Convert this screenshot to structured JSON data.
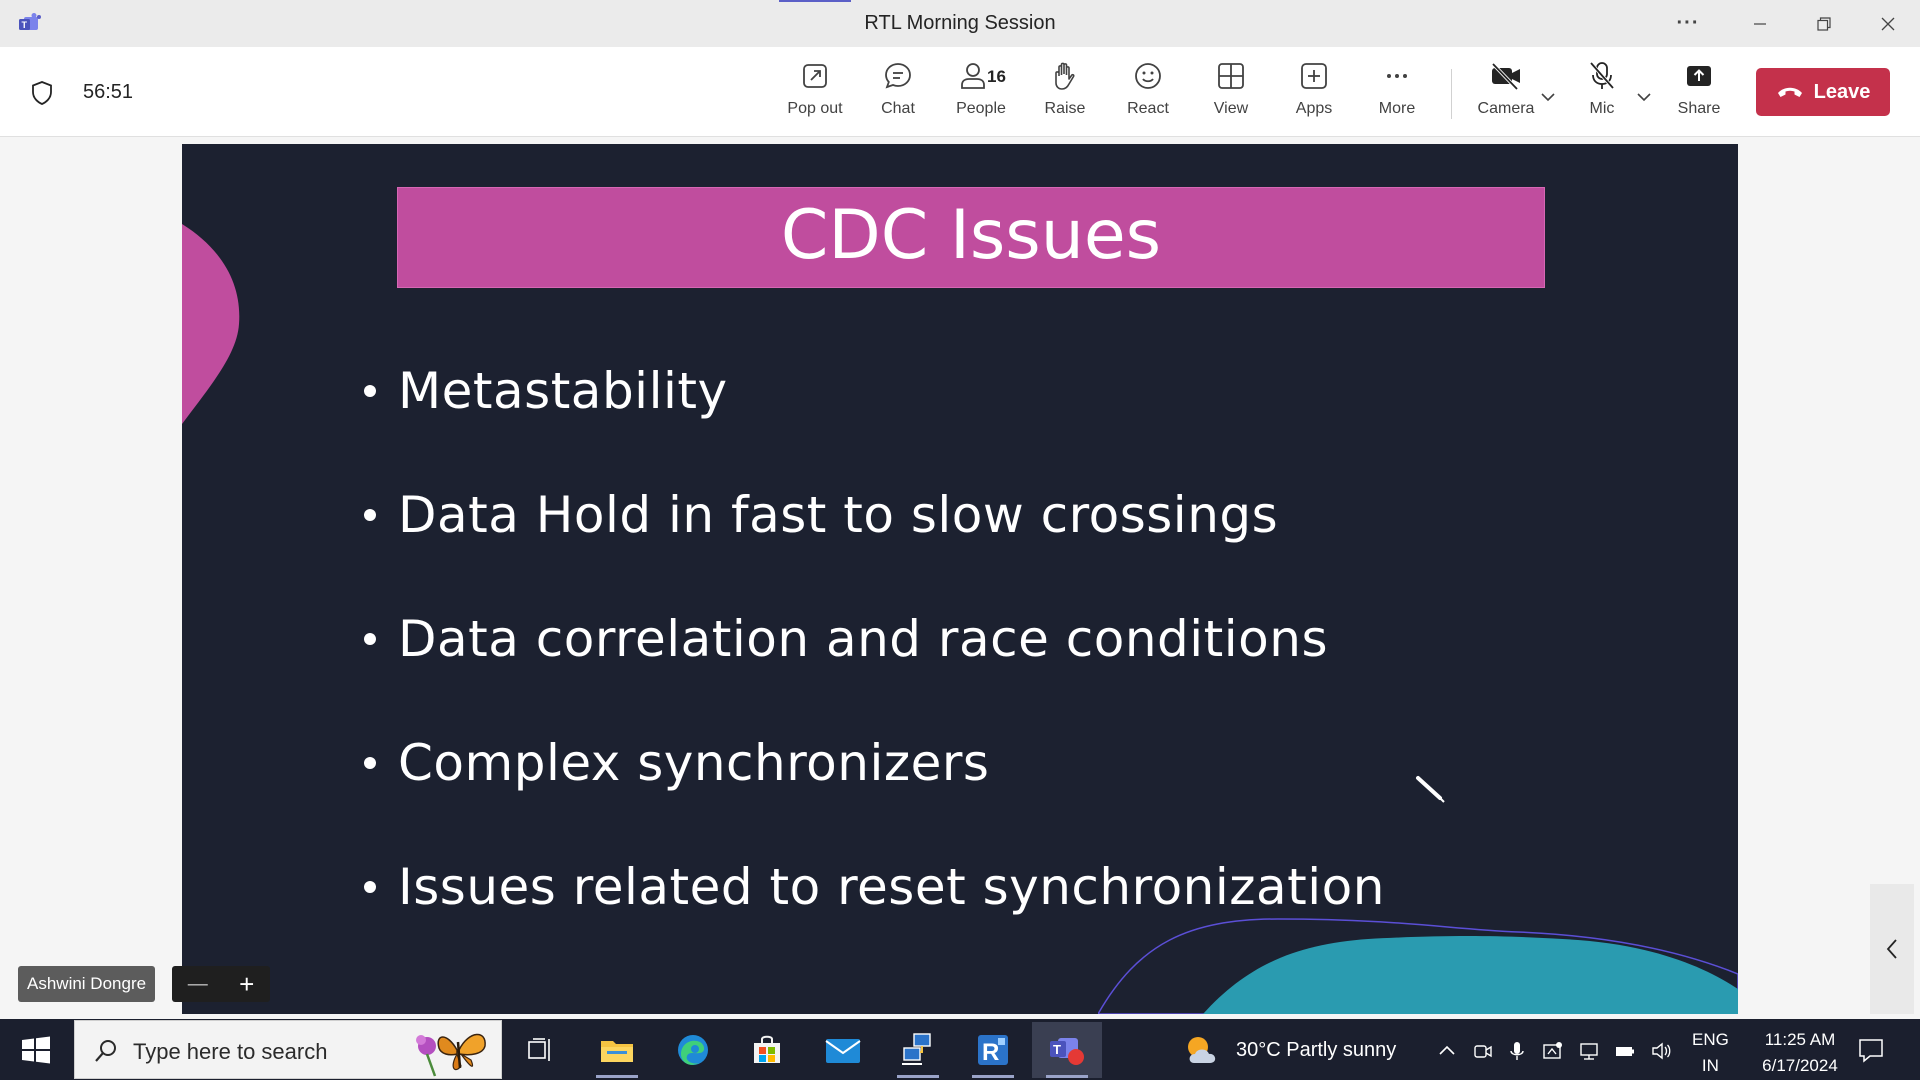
{
  "window": {
    "title": "RTL Morning Session",
    "more_label": "···"
  },
  "meeting": {
    "timer": "56:51",
    "toolbar": [
      {
        "id": "popout",
        "label": "Pop out",
        "icon": "pop-out-icon"
      },
      {
        "id": "chat",
        "label": "Chat",
        "icon": "chat-icon"
      },
      {
        "id": "people",
        "label": "People",
        "icon": "people-icon",
        "count": "16"
      },
      {
        "id": "raise",
        "label": "Raise",
        "icon": "raise-hand-icon"
      },
      {
        "id": "react",
        "label": "React",
        "icon": "smiley-icon"
      },
      {
        "id": "view",
        "label": "View",
        "icon": "grid-view-icon"
      },
      {
        "id": "apps",
        "label": "Apps",
        "icon": "add-app-icon"
      },
      {
        "id": "more",
        "label": "More",
        "icon": "more-dots-icon"
      },
      {
        "id": "camera",
        "label": "Camera",
        "icon": "camera-off-icon"
      },
      {
        "id": "mic",
        "label": "Mic",
        "icon": "mic-off-icon"
      },
      {
        "id": "share",
        "label": "Share",
        "icon": "share-icon"
      }
    ],
    "leave_label": "Leave",
    "leave_color": "#c4314b"
  },
  "slide": {
    "title": "CDC Issues",
    "bullets": [
      "Metastability",
      "Data Hold in fast to slow crossings",
      "Data correlation and race conditions",
      "Complex synchronizers",
      "Issues related to reset synchronization"
    ],
    "title_bg": "#c04d9e",
    "bg": "#1c2130"
  },
  "presenter": {
    "name": "Ashwini Dongre",
    "zoom_out": "—",
    "zoom_in": "+"
  },
  "taskbar": {
    "search_placeholder": "Type here to search",
    "weather": "30°C  Partly sunny",
    "lang_line1": "ENG",
    "lang_line2": "IN",
    "time": "11:25 AM",
    "date": "6/17/2024"
  }
}
